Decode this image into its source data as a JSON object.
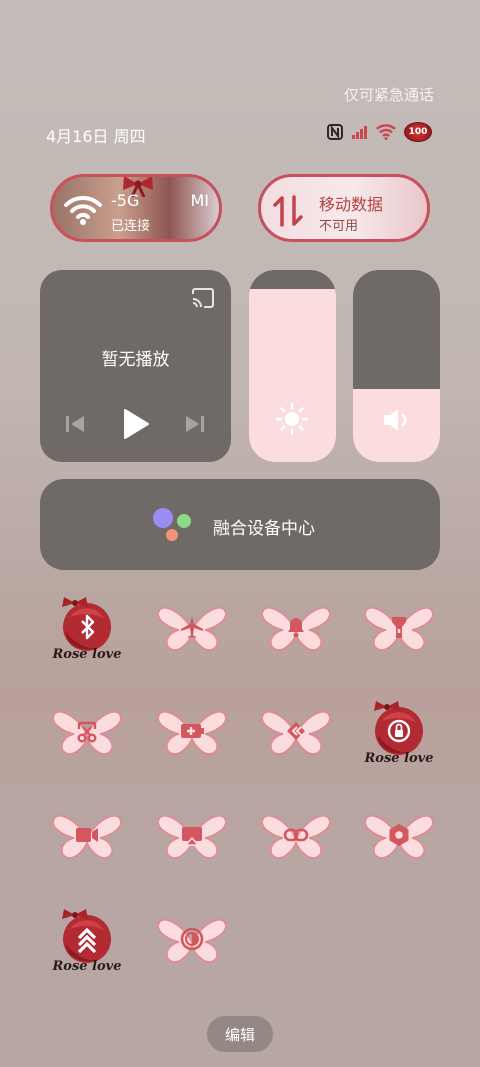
{
  "status_bar": {
    "emergency_text": "仅可紧急通话",
    "date_text": "4月16日 周四",
    "battery": "100"
  },
  "wifi_tile": {
    "name": "-5G",
    "status": "已连接",
    "overlay": "MI"
  },
  "data_tile": {
    "name": "移动数据",
    "status": "不可用"
  },
  "media": {
    "title": "暂无播放"
  },
  "sliders": {
    "brightness_level": 0.9,
    "volume_level": 0.38
  },
  "fusion": {
    "label": "融合设备中心"
  },
  "tiles": [
    {
      "name": "bluetooth",
      "style": "rose",
      "caption": "Rose love"
    },
    {
      "name": "airplane-mode",
      "style": "butterfly"
    },
    {
      "name": "notifications",
      "style": "butterfly"
    },
    {
      "name": "flashlight",
      "style": "butterfly"
    },
    {
      "name": "screenshot",
      "style": "butterfly"
    },
    {
      "name": "battery-saver",
      "style": "butterfly"
    },
    {
      "name": "code",
      "style": "butterfly"
    },
    {
      "name": "auto-rotate",
      "style": "rose",
      "caption": "Rose love"
    },
    {
      "name": "screen-record",
      "style": "butterfly"
    },
    {
      "name": "cast",
      "style": "butterfly"
    },
    {
      "name": "link",
      "style": "butterfly"
    },
    {
      "name": "settings",
      "style": "butterfly"
    },
    {
      "name": "upgrade",
      "style": "rose",
      "caption": "Rose love"
    },
    {
      "name": "dark-mode",
      "style": "butterfly"
    }
  ],
  "edit_button": {
    "label": "编辑"
  },
  "colors": {
    "accent_pink": "#fbdde0",
    "rose_red": "#c8505a",
    "card_gray": "#6f6a66"
  }
}
